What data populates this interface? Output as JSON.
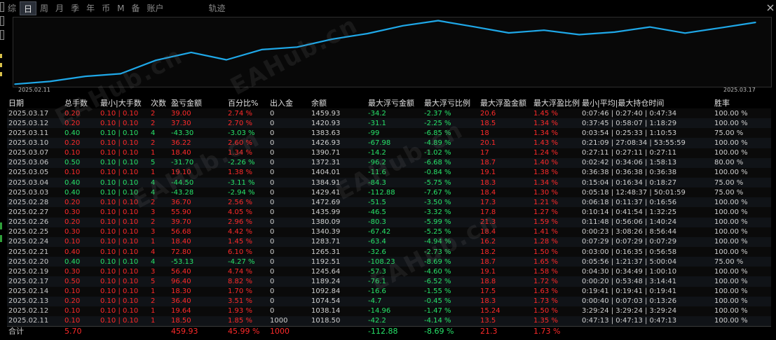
{
  "tabs": [
    "综",
    "日",
    "周",
    "月",
    "季",
    "年",
    "币",
    "M",
    "备",
    "账户",
    "轨迹"
  ],
  "active_tab": 1,
  "chart_data": {
    "type": "line",
    "x": [
      "2025.02.11",
      "2025.02.12",
      "2025.02.13",
      "2025.02.14",
      "2025.02.17",
      "2025.02.19",
      "2025.02.20",
      "2025.02.21",
      "2025.02.24",
      "2025.02.25",
      "2025.02.26",
      "2025.02.27",
      "2025.02.28",
      "2025.03.03",
      "2025.03.04",
      "2025.03.05",
      "2025.03.06",
      "2025.03.07",
      "2025.03.10",
      "2025.03.11",
      "2025.03.12",
      "2025.03.17"
    ],
    "values": [
      1018.5,
      1038.14,
      1074.54,
      1092.84,
      1189.24,
      1245.64,
      1192.51,
      1265.31,
      1283.71,
      1340.39,
      1380.09,
      1435.99,
      1472.69,
      1429.41,
      1384.91,
      1404.01,
      1372.31,
      1390.71,
      1426.93,
      1383.63,
      1420.93,
      1459.93
    ],
    "ylim": [
      1000,
      1480
    ],
    "xlabel_first": "2025.02.11",
    "xlabel_last": "2025.03.17",
    "line_color": "#1fa8e8"
  },
  "table": {
    "headers": [
      "日期",
      "总手数",
      "最小|大手数",
      "次数",
      "盈亏金额",
      "百分比%",
      "出入金",
      "余额",
      "最大浮亏金额",
      "最大浮亏比例",
      "最大浮盈金额",
      "最大浮盈比例",
      "最小|平均|最大持仓时间",
      "胜率"
    ],
    "rows": [
      [
        "2025.03.17",
        "0.20",
        "0.10 | 0.10",
        "2",
        "39.00",
        "2.74 %",
        "0",
        "1459.93",
        "-34.2",
        "-2.37 %",
        "20.6",
        "1.45 %",
        "0:07:46 | 0:27:40 | 0:47:34",
        "100.00 %"
      ],
      [
        "2025.03.12",
        "0.20",
        "0.10 | 0.10",
        "2",
        "37.30",
        "2.70 %",
        "0",
        "1420.93",
        "-31.1",
        "-2.25 %",
        "18.5",
        "1.34 %",
        "0:37:45 | 0:58:07 | 1:18:29",
        "100.00 %"
      ],
      [
        "2025.03.11",
        "0.40",
        "0.10 | 0.10",
        "4",
        "-43.30",
        "-3.03 %",
        "0",
        "1383.63",
        "-99",
        "-6.85 %",
        "18",
        "1.34 %",
        "0:03:54 | 0:25:33 | 1:10:53",
        "75.00 %"
      ],
      [
        "2025.03.10",
        "0.20",
        "0.10 | 0.10",
        "2",
        "36.22",
        "2.60 %",
        "0",
        "1426.93",
        "-67.98",
        "-4.89 %",
        "20.1",
        "1.43 %",
        "0:21:09 | 27:08:34 | 53:55:59",
        "100.00 %"
      ],
      [
        "2025.03.07",
        "0.10",
        "0.10 | 0.10",
        "1",
        "18.40",
        "1.34 %",
        "0",
        "1390.71",
        "-14.2",
        "-1.02 %",
        "17",
        "1.24 %",
        "0:27:11 | 0:27:11 | 0:27:11",
        "100.00 %"
      ],
      [
        "2025.03.06",
        "0.50",
        "0.10 | 0.10",
        "5",
        "-31.70",
        "-2.26 %",
        "0",
        "1372.31",
        "-96.2",
        "-6.68 %",
        "18.7",
        "1.40 %",
        "0:02:42 | 0:34:06 | 1:58:13",
        "80.00 %"
      ],
      [
        "2025.03.05",
        "0.10",
        "0.10 | 0.10",
        "1",
        "19.10",
        "1.38 %",
        "0",
        "1404.01",
        "-11.6",
        "-0.84 %",
        "19.1",
        "1.38 %",
        "0:36:38 | 0:36:38 | 0:36:38",
        "100.00 %"
      ],
      [
        "2025.03.04",
        "0.40",
        "0.10 | 0.10",
        "4",
        "-44.50",
        "-3.11 %",
        "0",
        "1384.91",
        "-84.3",
        "-5.75 %",
        "18.3",
        "1.34 %",
        "0:15:04 | 0:16:34 | 0:18:27",
        "75.00 %"
      ],
      [
        "2025.03.03",
        "0.40",
        "0.10 | 0.10",
        "4",
        "-43.28",
        "-2.94 %",
        "0",
        "1429.41",
        "-112.88",
        "-7.67 %",
        "18.4",
        "1.30 %",
        "0:05:18 | 12:48:37 | 50:01:59",
        "75.00 %"
      ],
      [
        "2025.02.28",
        "0.20",
        "0.10 | 0.10",
        "2",
        "36.70",
        "2.56 %",
        "0",
        "1472.69",
        "-51.5",
        "-3.50 %",
        "17.3",
        "1.21 %",
        "0:06:18 | 0:11:37 | 0:16:56",
        "100.00 %"
      ],
      [
        "2025.02.27",
        "0.30",
        "0.10 | 0.10",
        "3",
        "55.90",
        "4.05 %",
        "0",
        "1435.99",
        "-46.5",
        "-3.32 %",
        "17.8",
        "1.27 %",
        "0:10:14 | 0:41:54 | 1:32:25",
        "100.00 %"
      ],
      [
        "2025.02.26",
        "0.20",
        "0.10 | 0.10",
        "2",
        "39.70",
        "2.96 %",
        "0",
        "1380.09",
        "-80.3",
        "-5.99 %",
        "21.3",
        "1.59 %",
        "0:11:48 | 0:56:06 | 1:40:24",
        "100.00 %"
      ],
      [
        "2025.02.25",
        "0.30",
        "0.10 | 0.10",
        "3",
        "56.68",
        "4.42 %",
        "0",
        "1340.39",
        "-67.42",
        "-5.25 %",
        "18.4",
        "1.41 %",
        "0:00:23 | 3:08:26 | 8:56:44",
        "100.00 %"
      ],
      [
        "2025.02.24",
        "0.10",
        "0.10 | 0.10",
        "1",
        "18.40",
        "1.45 %",
        "0",
        "1283.71",
        "-63.4",
        "-4.94 %",
        "16.2",
        "1.28 %",
        "0:07:29 | 0:07:29 | 0:07:29",
        "100.00 %"
      ],
      [
        "2025.02.21",
        "0.40",
        "0.10 | 0.10",
        "4",
        "72.80",
        "6.10 %",
        "0",
        "1265.31",
        "-32.6",
        "-2.73 %",
        "18.2",
        "1.50 %",
        "0:03:00 | 0:16:35 | 0:56:58",
        "100.00 %"
      ],
      [
        "2025.02.20",
        "0.40",
        "0.10 | 0.10",
        "4",
        "-53.13",
        "-4.27 %",
        "0",
        "1192.51",
        "-108.23",
        "-8.69 %",
        "18.7",
        "1.65 %",
        "0:05:56 | 1:21:37 | 5:00:04",
        "75.00 %"
      ],
      [
        "2025.02.19",
        "0.30",
        "0.10 | 0.10",
        "3",
        "56.40",
        "4.74 %",
        "0",
        "1245.64",
        "-57.3",
        "-4.60 %",
        "19.1",
        "1.58 %",
        "0:04:30 | 0:34:49 | 1:00:10",
        "100.00 %"
      ],
      [
        "2025.02.17",
        "0.50",
        "0.10 | 0.10",
        "5",
        "96.40",
        "8.82 %",
        "0",
        "1189.24",
        "-76.1",
        "-6.52 %",
        "18.8",
        "1.72 %",
        "0:00:20 | 0:53:48 | 3:14:41",
        "100.00 %"
      ],
      [
        "2025.02.14",
        "0.10",
        "0.10 | 0.10",
        "1",
        "18.30",
        "1.70 %",
        "0",
        "1092.84",
        "-16.6",
        "-1.55 %",
        "17.5",
        "1.63 %",
        "0:19:41 | 0:19:41 | 0:19:41",
        "100.00 %"
      ],
      [
        "2025.02.13",
        "0.20",
        "0.10 | 0.10",
        "2",
        "36.40",
        "3.51 %",
        "0",
        "1074.54",
        "-4.7",
        "-0.45 %",
        "18.3",
        "1.73 %",
        "0:00:40 | 0:07:03 | 0:13:26",
        "100.00 %"
      ],
      [
        "2025.02.12",
        "0.10",
        "0.10 | 0.10",
        "1",
        "19.64",
        "1.93 %",
        "0",
        "1038.14",
        "-14.96",
        "-1.47 %",
        "15.24",
        "1.50 %",
        "3:29:24 | 3:29:24 | 3:29:24",
        "100.00 %"
      ],
      [
        "2025.02.11",
        "0.10",
        "0.10 | 0.10",
        "1",
        "18.50",
        "1.85 %",
        "1000",
        "1018.50",
        "-42.2",
        "-4.14 %",
        "13.5",
        "1.35 %",
        "0:47:13 | 0:47:13 | 0:47:13",
        "100.00 %"
      ]
    ],
    "total": [
      "合计",
      "5.70",
      "",
      "",
      "459.93",
      "45.99 %",
      "1000",
      "",
      "-112.88",
      "-8.69 %",
      "21.3",
      "1.73 %",
      "",
      ""
    ]
  },
  "watermark": "EAHub.cn",
  "colors": {
    "profit": "#ff2a2a",
    "loss": "#27e36a",
    "line": "#1fa8e8"
  }
}
